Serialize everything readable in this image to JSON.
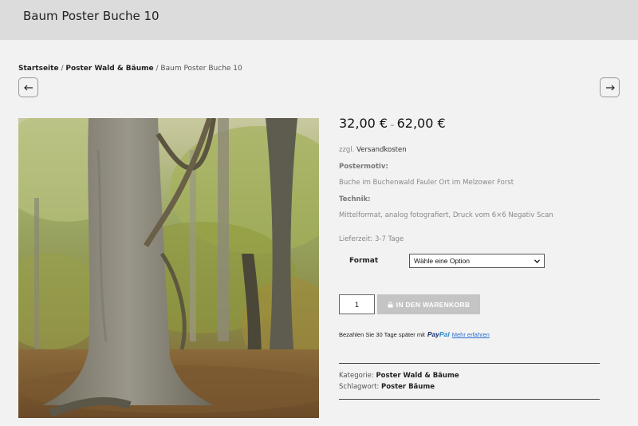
{
  "header": {
    "title": "Baum Poster Buche 10"
  },
  "breadcrumb": {
    "home": "Startseite",
    "separator": "/",
    "category": "Poster Wald & Bäume",
    "current": "Baum Poster Buche 10"
  },
  "navigation": {
    "prev_icon": "arrow-left-icon",
    "next_icon": "arrow-right-icon"
  },
  "product": {
    "price_min": "32,00 €",
    "price_dash": "–",
    "price_max": "62,00 €",
    "shipping_prefix": "zzgl.",
    "shipping_link": "Versandkosten",
    "motiv_label": "Postermotiv:",
    "motiv_value": "Buche im Buchenwald Fauler Ort im Melzower Forst",
    "technik_label": "Technik:",
    "technik_value": "Mittelformat, analog fotografiert, Druck vom 6×6 Negativ Scan",
    "delivery": "Lieferzeit: 3-7 Tage"
  },
  "variation": {
    "format_label": "Format",
    "format_selected": "Wähle eine Option"
  },
  "cart": {
    "quantity": "1",
    "button_label": "IN DEN WARENKORB",
    "button_icon": "lock-icon"
  },
  "paylater": {
    "text": "Bezahlen Sie 30 Tage später mit",
    "logo_pay": "Pay",
    "logo_pal": "Pal",
    "link": "Mehr erfahren"
  },
  "meta": {
    "category_label": "Kategorie:",
    "category_value": "Poster Wald & Bäume",
    "tag_label": "Schlagwort:",
    "tag_value": "Poster Bäume"
  },
  "colors": {
    "header_bg": "#dcdcdc",
    "page_bg": "#f2f2f2",
    "cart_button": "#c4c4c4",
    "paypal_dark": "#1a2f6b",
    "paypal_light": "#2a8ad0",
    "link_blue": "#2a6fd0"
  }
}
